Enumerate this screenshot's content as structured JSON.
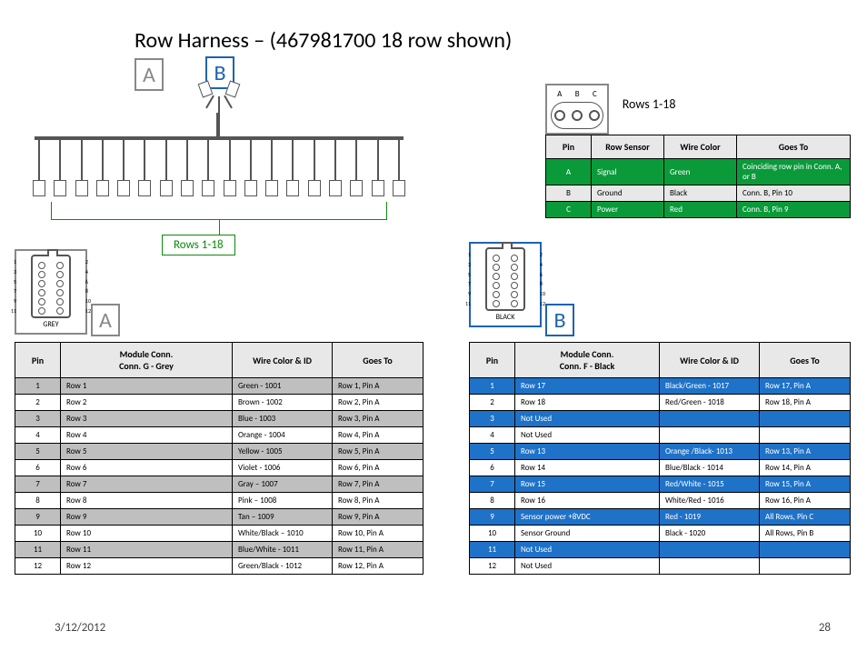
{
  "title": "Row Harness – (467981700   18 row shown)",
  "labels": {
    "A": "A",
    "B": "B"
  },
  "rows_range": "Rows  1-18",
  "footer": {
    "date": "3/12/2012",
    "page": "28"
  },
  "conn3": {
    "pins": [
      "A",
      "B",
      "C"
    ],
    "headers": [
      "Pin",
      "Row Sensor",
      "Wire Color",
      "Goes To"
    ],
    "rows": [
      {
        "pin": "A",
        "sensor": "Signal",
        "color": "Green",
        "goes": "Coinciding row pin in Conn.  A, or B",
        "cls": "row-green"
      },
      {
        "pin": "B",
        "sensor": "Ground",
        "color": "Black",
        "goes": "Conn. B, Pin 10",
        "cls": "row-grey"
      },
      {
        "pin": "C",
        "sensor": "Power",
        "color": "Red",
        "goes": "Conn. B, Pin 9",
        "cls": "row-green"
      }
    ]
  },
  "conn12": {
    "left_nums": [
      "1",
      "3",
      "5",
      "7",
      "9",
      "11"
    ],
    "right_nums": [
      "2",
      "4",
      "6",
      "8",
      "10",
      "12"
    ],
    "caption_a": "GREY",
    "caption_b": "BLACK"
  },
  "table_a": {
    "headers": [
      "Pin",
      "Module Conn.\nConn. G - Grey",
      "Wire Color & ID",
      "Goes To"
    ],
    "rows": [
      {
        "pin": "1",
        "mod": "Row 1",
        "wire": "Green - 1001",
        "goes": "Row 1, Pin A",
        "alt": true
      },
      {
        "pin": "2",
        "mod": "Row 2",
        "wire": "Brown - 1002",
        "goes": "Row 2, Pin A",
        "alt": false
      },
      {
        "pin": "3",
        "mod": "Row 3",
        "wire": "Blue - 1003",
        "goes": "Row 3, Pin A",
        "alt": true
      },
      {
        "pin": "4",
        "mod": "Row 4",
        "wire": "Orange - 1004",
        "goes": "Row 4, Pin A",
        "alt": false
      },
      {
        "pin": "5",
        "mod": "Row 5",
        "wire": "Yellow - 1005",
        "goes": "Row 5, Pin A",
        "alt": true
      },
      {
        "pin": "6",
        "mod": "Row 6",
        "wire": "Violet - 1006",
        "goes": "Row 6, Pin A",
        "alt": false
      },
      {
        "pin": "7",
        "mod": "Row 7",
        "wire": "Gray – 1007",
        "goes": "Row 7, Pin A",
        "alt": true
      },
      {
        "pin": "8",
        "mod": "Row 8",
        "wire": "Pink – 1008",
        "goes": "Row  8, Pin A",
        "alt": false
      },
      {
        "pin": "9",
        "mod": "Row 9",
        "wire": "Tan – 1009",
        "goes": "Row  9, Pin A",
        "alt": true
      },
      {
        "pin": "10",
        "mod": "Row 10",
        "wire": "White/Black – 1010",
        "goes": "Row  10, Pin A",
        "alt": false
      },
      {
        "pin": "11",
        "mod": "Row 11",
        "wire": "Blue/White - 1011",
        "goes": "Row 11, Pin A",
        "alt": true
      },
      {
        "pin": "12",
        "mod": "Row 12",
        "wire": "Green/Black - 1012",
        "goes": "Row  12, Pin A",
        "alt": false
      }
    ]
  },
  "table_b": {
    "headers": [
      "Pin",
      "Module Conn.\nConn. F - Black",
      "Wire Color & ID",
      "Goes To"
    ],
    "rows": [
      {
        "pin": "1",
        "mod": "Row 17",
        "wire": "Black/Green - 1017",
        "goes": "Row 17, Pin A",
        "blue": true
      },
      {
        "pin": "2",
        "mod": "Row 18",
        "wire": "Red/Green - 1018",
        "goes": "Row 18, Pin A",
        "blue": false
      },
      {
        "pin": "3",
        "mod": "Not Used",
        "wire": "",
        "goes": "",
        "blue": true
      },
      {
        "pin": "4",
        "mod": "Not Used",
        "wire": "",
        "goes": "",
        "blue": false
      },
      {
        "pin": "5",
        "mod": "Row 13",
        "wire": "Orange /Black- 1013",
        "goes": "Row 13, Pin A",
        "blue": true
      },
      {
        "pin": "6",
        "mod": "Row 14",
        "wire": "Blue/Black - 1014",
        "goes": "Row 14, Pin A",
        "blue": false
      },
      {
        "pin": "7",
        "mod": "Row 15",
        "wire": "Red/White - 1015",
        "goes": "Row 15, Pin A",
        "blue": true
      },
      {
        "pin": "8",
        "mod": "Row 16",
        "wire": "White/Red - 1016",
        "goes": "Row 16, Pin A",
        "blue": false
      },
      {
        "pin": "9",
        "mod": "Sensor power +8VDC",
        "wire": "Red - 1019",
        "goes": "All Rows,  Pin C",
        "blue": true
      },
      {
        "pin": "10",
        "mod": "Sensor Ground",
        "wire": "Black - 1020",
        "goes": "All Rows, Pin B",
        "blue": false
      },
      {
        "pin": "11",
        "mod": "Not Used",
        "wire": "",
        "goes": "",
        "blue": true
      },
      {
        "pin": "12",
        "mod": "Not Used",
        "wire": "",
        "goes": "",
        "blue": false
      }
    ]
  }
}
